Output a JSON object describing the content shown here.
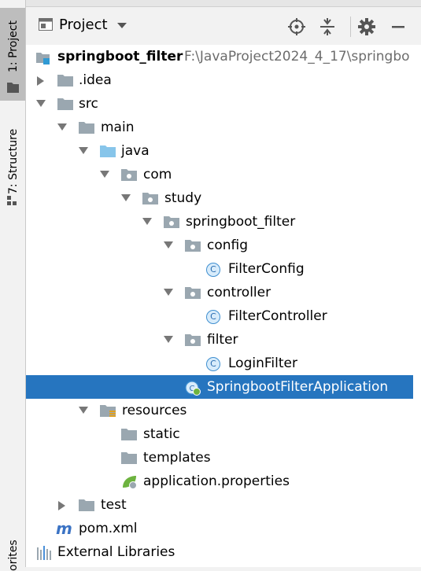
{
  "tool_strip": {
    "project_tab": "1: Project",
    "structure_tab": "7: Structure",
    "favorites_tab": "orites"
  },
  "header": {
    "title": "Project",
    "icons": [
      "locate-icon",
      "collapse-all-icon",
      "gear-icon",
      "minimize-icon"
    ]
  },
  "tree": {
    "root": {
      "name": "springboot_filter",
      "path": "F:\\JavaProject2024_4_17\\springbo"
    },
    "items": [
      {
        "label": ".idea"
      },
      {
        "label": "src"
      },
      {
        "label": "main"
      },
      {
        "label": "java"
      },
      {
        "label": "com"
      },
      {
        "label": "study"
      },
      {
        "label": "springboot_filter"
      },
      {
        "label": "config"
      },
      {
        "label": "FilterConfig"
      },
      {
        "label": "controller"
      },
      {
        "label": "FilterController"
      },
      {
        "label": "filter"
      },
      {
        "label": "LoginFilter"
      },
      {
        "label": "SpringbootFilterApplication"
      },
      {
        "label": "resources"
      },
      {
        "label": "static"
      },
      {
        "label": "templates"
      },
      {
        "label": "application.properties"
      },
      {
        "label": "test"
      },
      {
        "label": "pom.xml"
      },
      {
        "label": "External Libraries"
      }
    ]
  },
  "colors": {
    "selection": "#2675bf",
    "folder": "#9aa7b0",
    "java_folder": "#87c5ea",
    "class_icon": "#3f8fd0"
  }
}
